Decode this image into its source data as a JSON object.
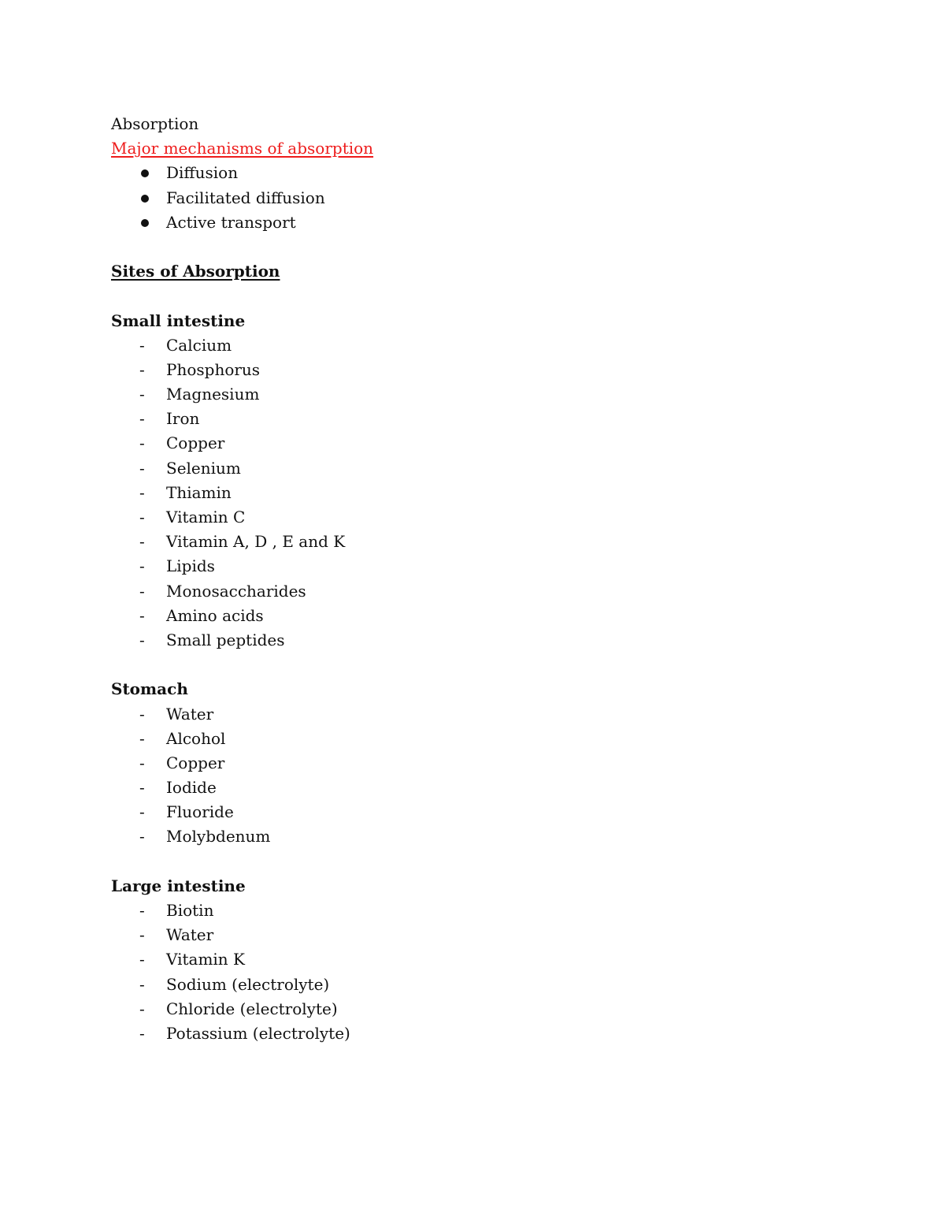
{
  "document": {
    "title": "Absorption",
    "mechanisms_heading": "Major mechanisms of absorption",
    "mechanisms_color": "#ee1c1c",
    "mechanisms": [
      "Diffusion",
      "Facilitated diffusion",
      "Active transport"
    ],
    "sites_heading": "Sites of Absorption",
    "dash_marker": "-",
    "sections": [
      {
        "heading": "Small intestine",
        "items": [
          "Calcium",
          "Phosphorus",
          "Magnesium",
          "Iron",
          "Copper",
          "Selenium",
          "Thiamin",
          "Vitamin C",
          "Vitamin A, D , E and K",
          "Lipids",
          "Monosaccharides",
          "Amino acids",
          "Small peptides"
        ]
      },
      {
        "heading": "Stomach",
        "items": [
          "Water",
          "Alcohol",
          "Copper",
          "Iodide",
          "Fluoride",
          "Molybdenum"
        ]
      },
      {
        "heading": "Large intestine",
        "items": [
          "Biotin",
          "Water",
          "Vitamin K",
          "Sodium (electrolyte)",
          "Chloride (electrolyte)",
          "Potassium (electrolyte)"
        ]
      }
    ]
  }
}
